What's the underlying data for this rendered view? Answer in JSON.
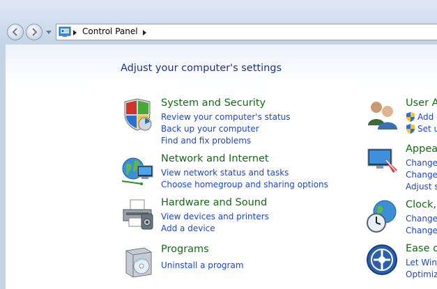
{
  "breadcrumb": {
    "root": "Control Panel"
  },
  "page_title": "Adjust your computer's settings",
  "categories_left": [
    {
      "title": "System and Security",
      "icon": "shield-icon",
      "links": [
        "Review your computer's status",
        "Back up your computer",
        "Find and fix problems"
      ]
    },
    {
      "title": "Network and Internet",
      "icon": "globe-network-icon",
      "links": [
        "View network status and tasks",
        "Choose homegroup and sharing options"
      ]
    },
    {
      "title": "Hardware and Sound",
      "icon": "printer-icon",
      "links": [
        "View devices and printers",
        "Add a device"
      ]
    },
    {
      "title": "Programs",
      "icon": "programs-box-icon",
      "links": [
        "Uninstall a program"
      ]
    }
  ],
  "categories_right": [
    {
      "title": "User A",
      "icon": "users-icon",
      "links": [
        "Add c",
        "Set u"
      ]
    },
    {
      "title": "Appea",
      "icon": "appearance-monitor-icon",
      "links": [
        "Change",
        "Change",
        "Adjust s"
      ]
    },
    {
      "title": "Clock,",
      "icon": "clock-globe-icon",
      "links": [
        "Change",
        "Change"
      ]
    },
    {
      "title": "Ease o",
      "icon": "ease-of-access-icon",
      "links": [
        "Let Wind",
        "Optimiz"
      ]
    }
  ]
}
